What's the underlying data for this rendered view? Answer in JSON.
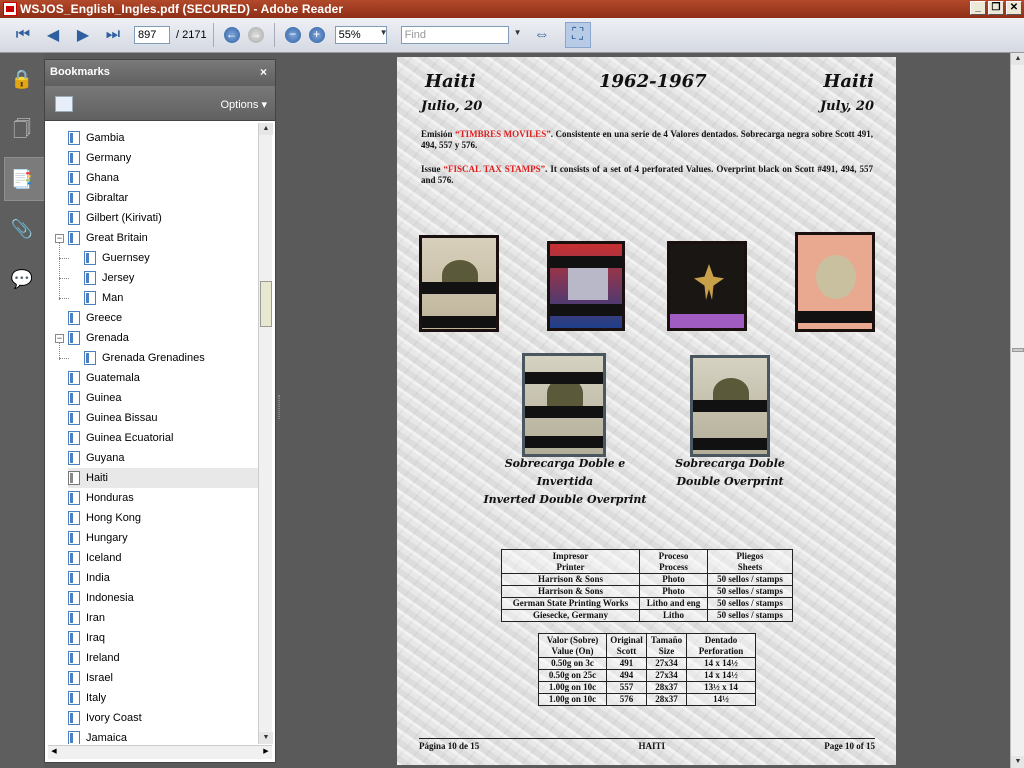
{
  "window": {
    "title": "WSJOS_English_Ingles.pdf (SECURED) - Adobe Reader"
  },
  "toolbar": {
    "page_current": "897",
    "page_total": "/ 2171",
    "zoom": "55%",
    "find_placeholder": "Find"
  },
  "bookmarks": {
    "title": "Bookmarks",
    "close": "×",
    "options_label": "Options",
    "items": [
      {
        "label": "Gambia",
        "level": 0
      },
      {
        "label": "Germany",
        "level": 0
      },
      {
        "label": "Ghana",
        "level": 0
      },
      {
        "label": "Gibraltar",
        "level": 0
      },
      {
        "label": "Gilbert (Kirivati)",
        "level": 0
      },
      {
        "label": "Great Britain",
        "level": 0,
        "expanded": true
      },
      {
        "label": "Guernsey",
        "level": 1
      },
      {
        "label": "Jersey",
        "level": 1
      },
      {
        "label": "Man",
        "level": 1
      },
      {
        "label": "Greece",
        "level": 0
      },
      {
        "label": "Grenada",
        "level": 0,
        "expanded": true
      },
      {
        "label": "Grenada Grenadines",
        "level": 1
      },
      {
        "label": "Guatemala",
        "level": 0
      },
      {
        "label": "Guinea",
        "level": 0
      },
      {
        "label": "Guinea Bissau",
        "level": 0
      },
      {
        "label": "Guinea Ecuatorial",
        "level": 0
      },
      {
        "label": "Guyana",
        "level": 0
      },
      {
        "label": "Haiti",
        "level": 0,
        "selected": true
      },
      {
        "label": "Honduras",
        "level": 0
      },
      {
        "label": "Hong Kong",
        "level": 0
      },
      {
        "label": "Hungary",
        "level": 0
      },
      {
        "label": "Iceland",
        "level": 0
      },
      {
        "label": "India",
        "level": 0
      },
      {
        "label": "Indonesia",
        "level": 0
      },
      {
        "label": "Iran",
        "level": 0
      },
      {
        "label": "Iraq",
        "level": 0
      },
      {
        "label": "Ireland",
        "level": 0
      },
      {
        "label": "Israel",
        "level": 0
      },
      {
        "label": "Italy",
        "level": 0
      },
      {
        "label": "Ivory Coast",
        "level": 0
      },
      {
        "label": "Jamaica",
        "level": 0
      }
    ]
  },
  "doc": {
    "left_title": "Haiti",
    "center_title": "1962-1967",
    "right_title": "Haiti",
    "left_date": "Julio, 20",
    "right_date": "July, 20",
    "para1_a": "Emisión ",
    "para1_red": "“TIMBRES MOVILES”",
    "para1_b": ". Consistente en una serie de 4 Valores dentados. Sobrecarga negra sobre Scott 491, 494, 557 y 576.",
    "para2_a": "Issue ",
    "para2_red": "“FISCAL TAX STAMPS”",
    "para2_b": ". It consists of a set of 4 perforated Values. Overprint black on Scott #491, 494, 557 and 576.",
    "caption1_l1": "Sobrecarga Doble e Invertida",
    "caption1_l2": "Inverted Double Overprint",
    "caption2_l1": "Sobrecarga Doble",
    "caption2_l2": "Double Overprint",
    "table1": {
      "headers": [
        [
          "Impresor",
          "Printer"
        ],
        [
          "Proceso",
          "Process"
        ],
        [
          "Pliegos",
          "Sheets"
        ]
      ],
      "rows": [
        [
          "Harrison & Sons",
          "Photo",
          "50 sellos / stamps"
        ],
        [
          "Harrison & Sons",
          "Photo",
          "50 sellos / stamps"
        ],
        [
          "German State Printing Works",
          "Litho and eng",
          "50 sellos / stamps"
        ],
        [
          "Giesecke, Germany",
          "Litho",
          "50 sellos / stamps"
        ]
      ]
    },
    "table2": {
      "headers": [
        [
          "Valor (Sobre)",
          "Value (On)"
        ],
        [
          "Original",
          "Scott"
        ],
        [
          "Tamaño",
          "Size"
        ],
        [
          "Dentado",
          "Perforation"
        ]
      ],
      "rows": [
        [
          "0.50g on 3c",
          "491",
          "27x34",
          "14 x 14½"
        ],
        [
          "0.50g on 25c",
          "494",
          "27x34",
          "14 x 14½"
        ],
        [
          "1.00g on 10c",
          "557",
          "28x37",
          "13½ x 14"
        ],
        [
          "1.00g on 10c",
          "576",
          "28x37",
          "14½"
        ]
      ]
    },
    "footer_left": "Página 10 de 15",
    "footer_center": "HAITI",
    "footer_right": "Page 10 of 15"
  },
  "colors": {
    "accent_red": "#e02020",
    "titlebar": "#a0401f"
  }
}
